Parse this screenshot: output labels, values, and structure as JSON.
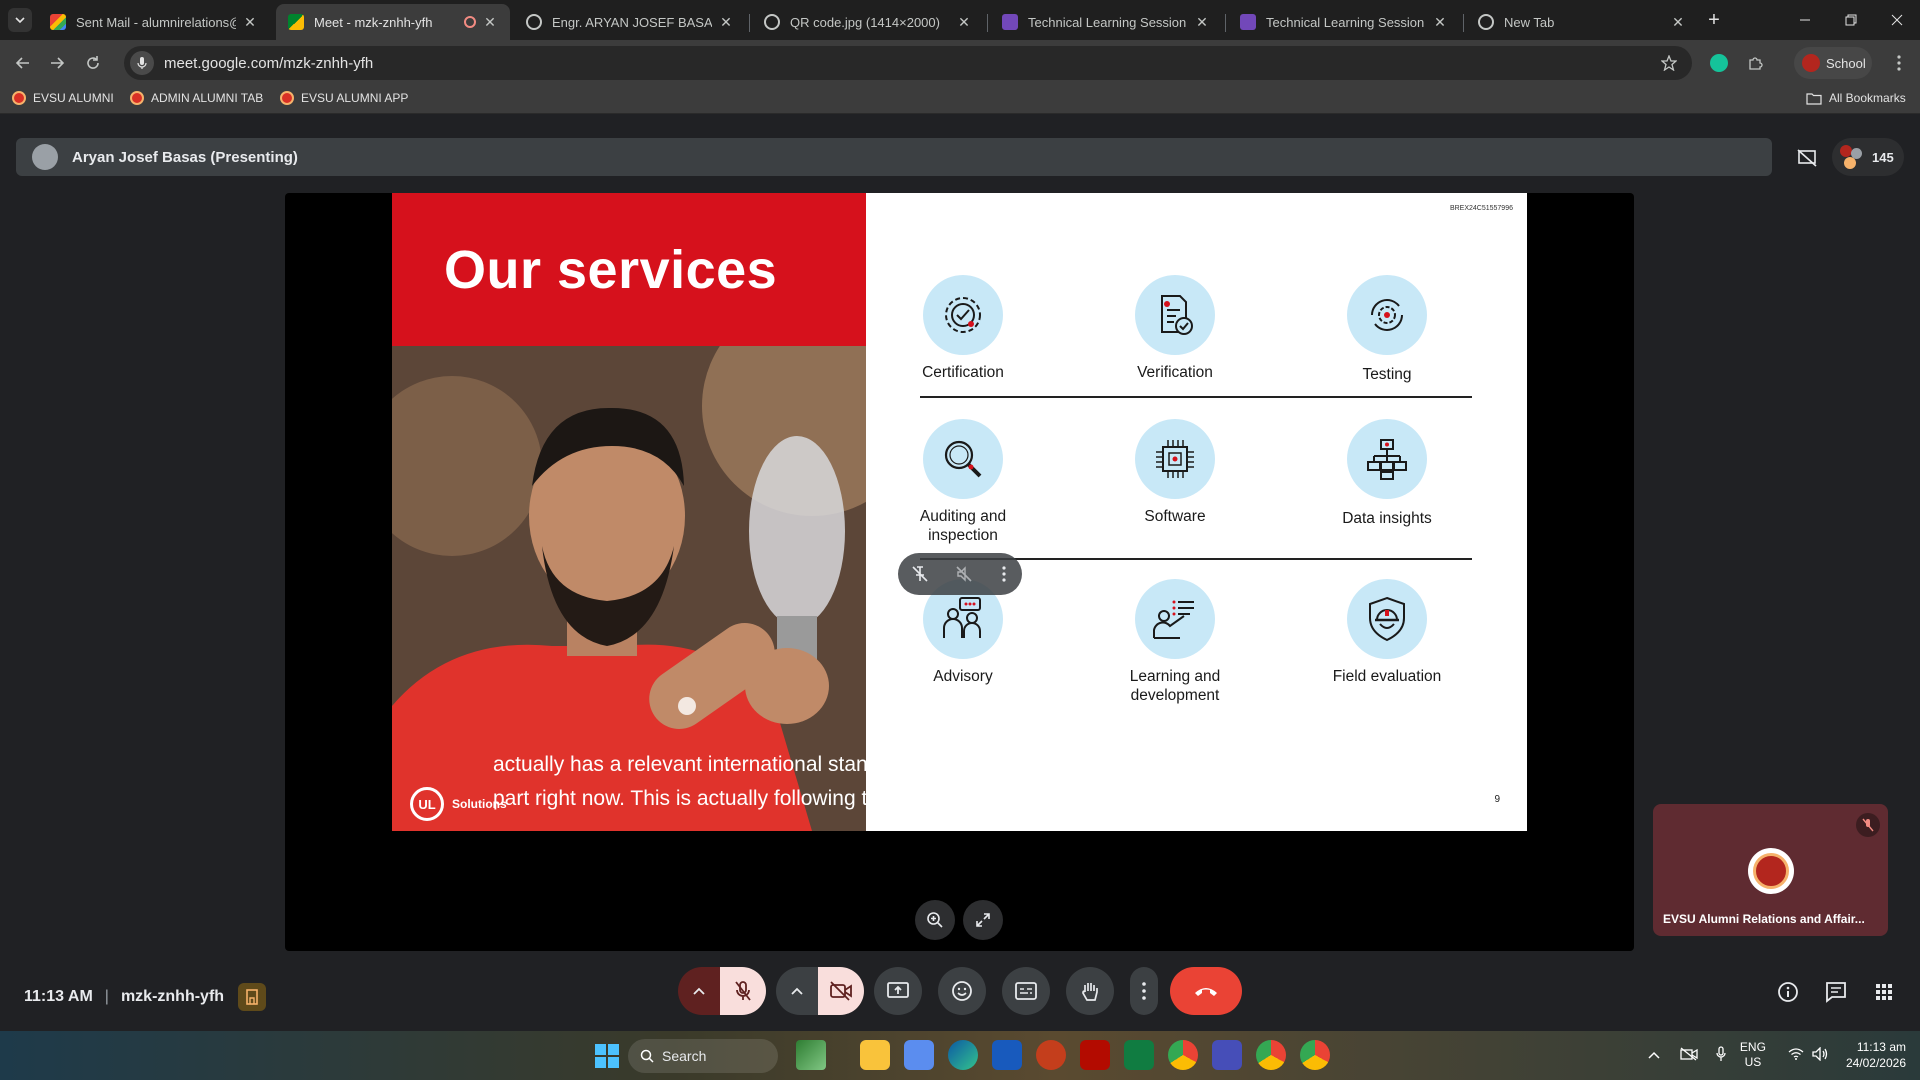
{
  "browser": {
    "tabs": [
      {
        "title": "Sent Mail - alumnirelations@ev",
        "icon": "gmail-icon",
        "active": false
      },
      {
        "title": "Meet - mzk-znhh-yfh",
        "icon": "meet-icon",
        "active": true
      },
      {
        "title": "Engr. ARYAN JOSEF BASAS.png",
        "icon": "globe-icon",
        "active": false
      },
      {
        "title": "QR code.jpg (1414×2000)",
        "icon": "globe-icon",
        "active": false
      },
      {
        "title": "Technical Learning Session on U",
        "icon": "forms-icon",
        "active": false
      },
      {
        "title": "Technical Learning Session on U",
        "icon": "forms-icon",
        "active": false
      },
      {
        "title": "New Tab",
        "icon": "chrome-icon",
        "active": false
      }
    ],
    "url": "meet.google.com/mzk-znhh-yfh",
    "profile_label": "School",
    "bookmarks": [
      "EVSU ALUMNI",
      "ADMIN ALUMNI TAB",
      "EVSU ALUMNI APP"
    ],
    "all_bookmarks_label": "All Bookmarks"
  },
  "meet": {
    "presenter_label": "Aryan Josef Basas (Presenting)",
    "participant_count": "145",
    "slide": {
      "title": "Our services",
      "code": "BREX24C51557996",
      "page_number": "9",
      "logo_text": "Solutions",
      "logo_mark": "UL",
      "services": [
        {
          "label": "Certification",
          "icon": "gear-check-icon"
        },
        {
          "label": "Verification",
          "icon": "document-check-icon"
        },
        {
          "label": "Testing",
          "icon": "gear-cycle-icon"
        },
        {
          "label": "Auditing and inspection",
          "icon": "magnifier-icon"
        },
        {
          "label": "Software",
          "icon": "chip-icon"
        },
        {
          "label": "Data insights",
          "icon": "hierarchy-icon"
        },
        {
          "label": "Advisory",
          "icon": "people-chat-icon"
        },
        {
          "label": "Learning and development",
          "icon": "person-board-icon"
        },
        {
          "label": "Field evaluation",
          "icon": "helmet-shield-icon"
        }
      ]
    },
    "caption_line1": "actually has a relevant international standards. So I'm actually focused on the certification",
    "caption_line2": "part right now. This is actually following th",
    "self_tile_name": "EVSU Alumni Relations and Affair...",
    "time": "11:13 AM",
    "meeting_code": "mzk-znhh-yfh"
  },
  "taskbar": {
    "search_placeholder": "Search",
    "lang_top": "ENG",
    "lang_bottom": "US",
    "clock_time": "11:13 am",
    "clock_date": "24/02/2026"
  },
  "colors": {
    "slide_red": "#d6111c",
    "icon_circle": "#c8e8f7",
    "end_call_red": "#ea4335",
    "meet_bg": "#202124"
  }
}
